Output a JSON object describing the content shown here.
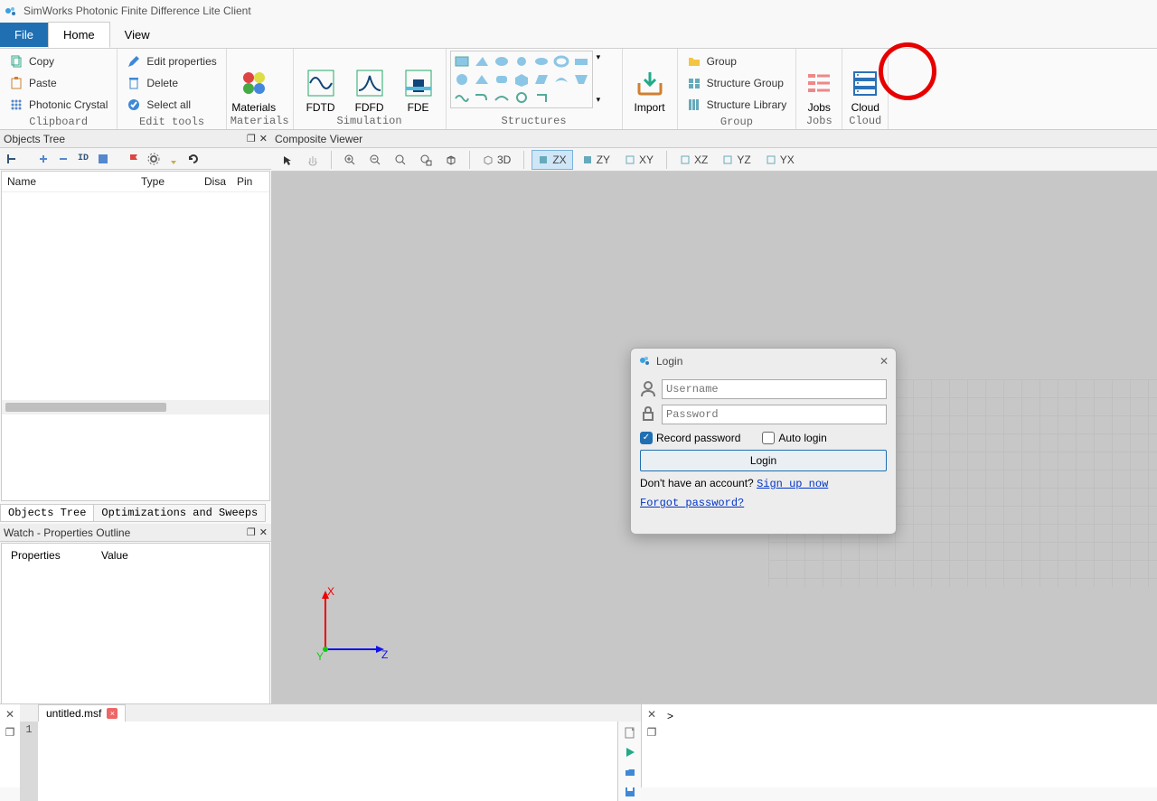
{
  "title": "SimWorks Photonic Finite Difference Lite Client",
  "menu": {
    "file": "File",
    "home": "Home",
    "view": "View"
  },
  "ribbon": {
    "clipboard": {
      "label": "Clipboard",
      "copy": "Copy",
      "paste": "Paste",
      "pc": "Photonic Crystal"
    },
    "edit": {
      "label": "Edit tools",
      "edit": "Edit properties",
      "del": "Delete",
      "sel": "Select all"
    },
    "materials": {
      "label": "Materials",
      "btn": "Materials"
    },
    "sim": {
      "label": "Simulation",
      "fdtd": "FDTD",
      "fdfd": "FDFD",
      "fde": "FDE"
    },
    "struct": {
      "label": "Structures"
    },
    "import": {
      "label": "",
      "btn": "Import"
    },
    "group": {
      "label": "Group",
      "group": "Group",
      "sgroup": "Structure Group",
      "lib": "Structure Library"
    },
    "jobs": {
      "label": "Jobs",
      "btn": "Jobs"
    },
    "cloud": {
      "label": "Cloud",
      "btn": "Cloud"
    }
  },
  "panels": {
    "objtree": "Objects Tree",
    "viewer": "Composite Viewer",
    "watch": "Watch - Properties Outline"
  },
  "objtree": {
    "cols": {
      "name": "Name",
      "type": "Type",
      "disa": "Disa",
      "pin": "Pin"
    },
    "tabs": {
      "tree": "Objects Tree",
      "opt": "Optimizations and Sweeps"
    }
  },
  "watch": {
    "props": "Properties",
    "value": "Value"
  },
  "viewer_toolbar": {
    "d3": "3D",
    "zx": "ZX",
    "zy": "ZY",
    "xy": "XY",
    "xz": "XZ",
    "yz": "YZ",
    "yx": "YX"
  },
  "axes": {
    "x": "X",
    "y": "Y",
    "z": "Z"
  },
  "login": {
    "title": "Login",
    "user_ph": "Username",
    "pass_ph": "Password",
    "record": "Record password",
    "auto": "Auto login",
    "login_btn": "Login",
    "noacct": "Don't have an account?",
    "signup": "Sign up now",
    "forgot": "Forgot password?"
  },
  "script": {
    "tab": "untitled.msf",
    "line": "1",
    "prompt": ">"
  }
}
